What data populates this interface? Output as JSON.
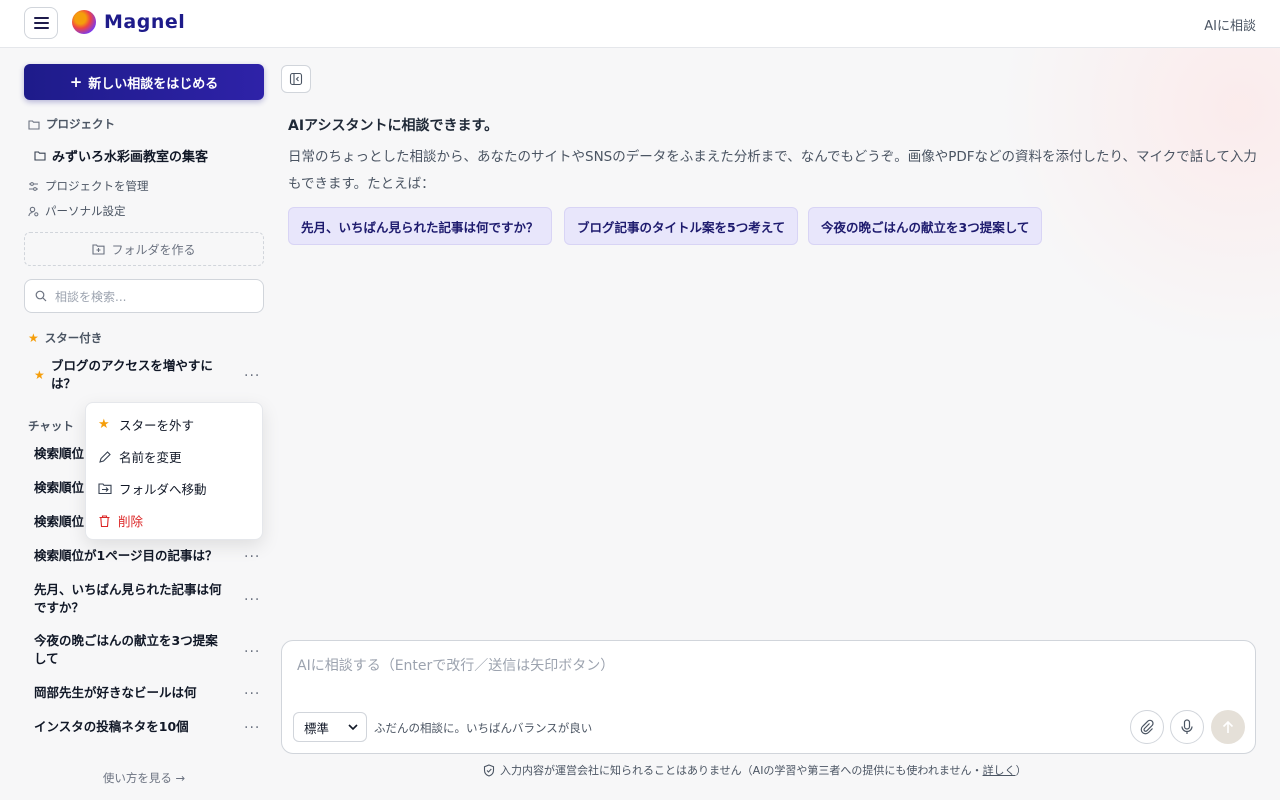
{
  "header": {
    "logo_text": "Magnel",
    "right_text": "AIに相談"
  },
  "sidebar": {
    "new_chat_label": "新しい相談をはじめる",
    "projects_label": "プロジェクト",
    "project_item": "みずいろ水彩画教室の集客",
    "manage_projects": "プロジェクトを管理",
    "personal_settings": "パーソナル設定",
    "make_folder": "フォルダを作る",
    "search_placeholder": "相談を検索...",
    "starred_label": "スター付き",
    "starred_items": [
      {
        "title": "ブログのアクセスを増やすには？"
      }
    ],
    "chat_label": "チャット",
    "chats": [
      {
        "title": "検索順位"
      },
      {
        "title": "検索順位"
      },
      {
        "title": "検索順位"
      },
      {
        "title": "検索順位が1ページ目の記事は？"
      },
      {
        "title": "先月、いちばん見られた記事は何ですか？"
      },
      {
        "title": "今夜の晩ごはんの献立を3つ提案して"
      },
      {
        "title": "岡部先生が好きなビールは何"
      },
      {
        "title": "インスタの投稿ネタを10個"
      }
    ],
    "howto": "使い方を見る →"
  },
  "context_menu": {
    "unstar": "スターを外す",
    "rename": "名前を変更",
    "move": "フォルダへ移動",
    "delete": "削除"
  },
  "main": {
    "intro_title": "AIアシスタントに相談できます。",
    "intro_body": "日常のちょっとした相談から、あなたのサイトやSNSのデータをふまえた分析まで、なんでもどうぞ。画像やPDFなどの資料を添付したり、マイクで話して入力もできます。たとえば：",
    "suggestions": [
      "先月、いちばん見られた記事は何ですか？",
      "ブログ記事のタイトル案を5つ考えて",
      "今夜の晩ごはんの献立を3つ提案して"
    ],
    "composer_placeholder": "AIに相談する（Enterで改行／送信は矢印ボタン）",
    "mode_selected": "標準",
    "mode_desc": "ふだんの相談に。いちばんバランスが良い",
    "privacy_text": "入力内容が運営会社に知られることはありません（AIの学習や第三者への提供にも使われません・",
    "privacy_link": "詳しく",
    "privacy_close": "）"
  },
  "colors": {
    "brand": "#1e1b8a",
    "star": "#f59e0b",
    "danger": "#dc2626",
    "chip_bg": "#e8e6fb"
  }
}
